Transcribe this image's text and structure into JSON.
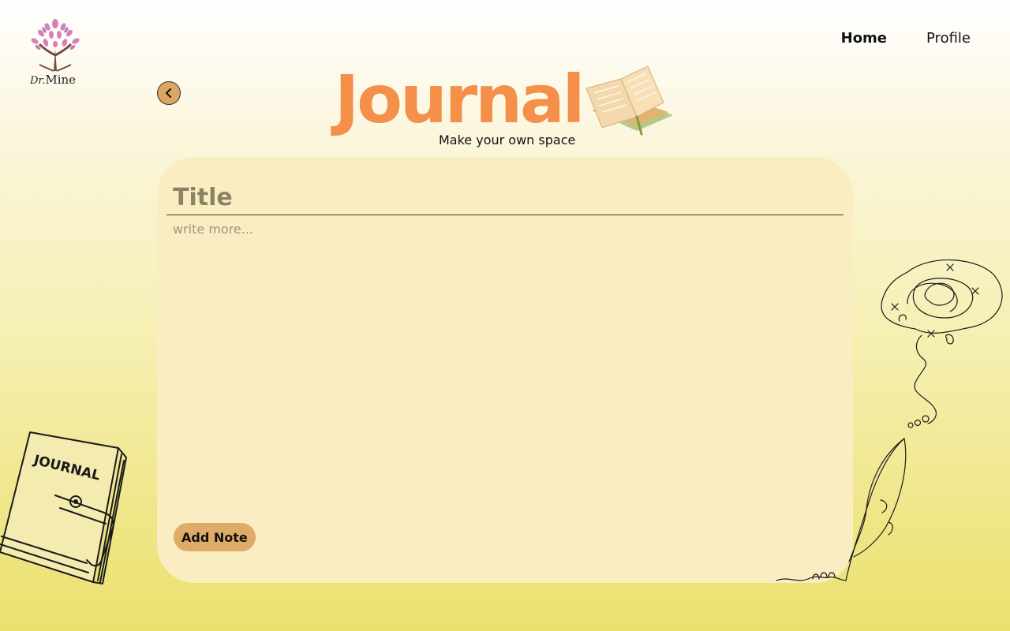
{
  "logo": {
    "prefix": "Dr.",
    "name": "Mine",
    "icon": "tree-logo-icon"
  },
  "nav": {
    "home": "Home",
    "profile": "Profile"
  },
  "back": {
    "icon": "chevron-left-icon"
  },
  "heading": {
    "title": "Journal",
    "subtitle": "Make your own space",
    "icon": "open-book-icon"
  },
  "editor": {
    "title_placeholder": "Title",
    "title_value": "",
    "body_placeholder": "write more...",
    "body_value": "",
    "add_label": "Add Note"
  },
  "decorations": {
    "journal_cover_text": "JOURNAL"
  },
  "colors": {
    "accent": "#f4904a",
    "button": "#dfab68",
    "card": "#fbedc2",
    "bg_bottom": "#ebe06d"
  }
}
